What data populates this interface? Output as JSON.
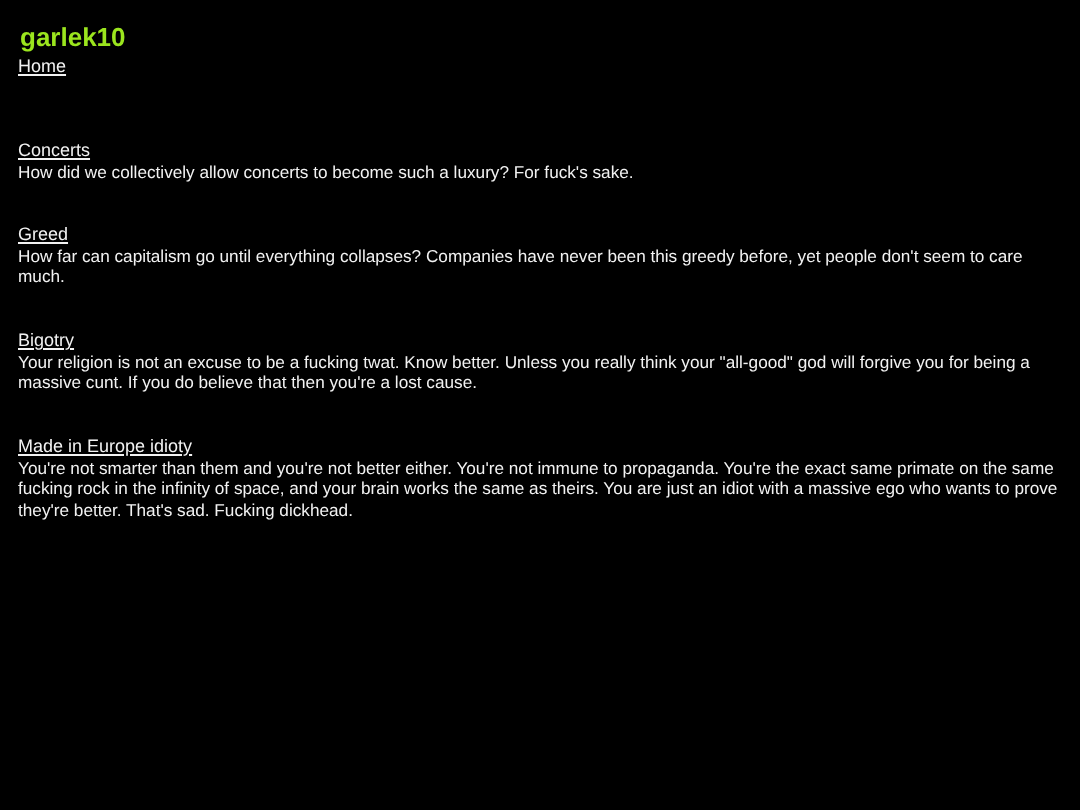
{
  "site": {
    "logo": "garlek10",
    "nav": [
      "Home"
    ]
  },
  "posts": [
    {
      "title": "Concerts",
      "body": "How did we collectively allow concerts to become such a luxury? For fuck's sake."
    },
    {
      "title": "Greed",
      "body": "How far can capitalism go until everything collapses? Companies have never been this greedy before, yet people don't seem to care much."
    },
    {
      "title": "Bigotry",
      "body": "Your religion is not an excuse to be a fucking twat. Know better. Unless you really think your \"all-good\" god will forgive you for being a massive cunt. If you do believe that then you're a lost cause."
    },
    {
      "title": "Made in Europe idioty",
      "body": "You're not smarter than them and you're not better either. You're not immune to propaganda. You're the exact same primate on the same fucking rock in the infinity of space, and your brain works the same as theirs. You are just an idiot with a massive ego who wants to prove they're better. That's sad. Fucking dickhead."
    }
  ]
}
